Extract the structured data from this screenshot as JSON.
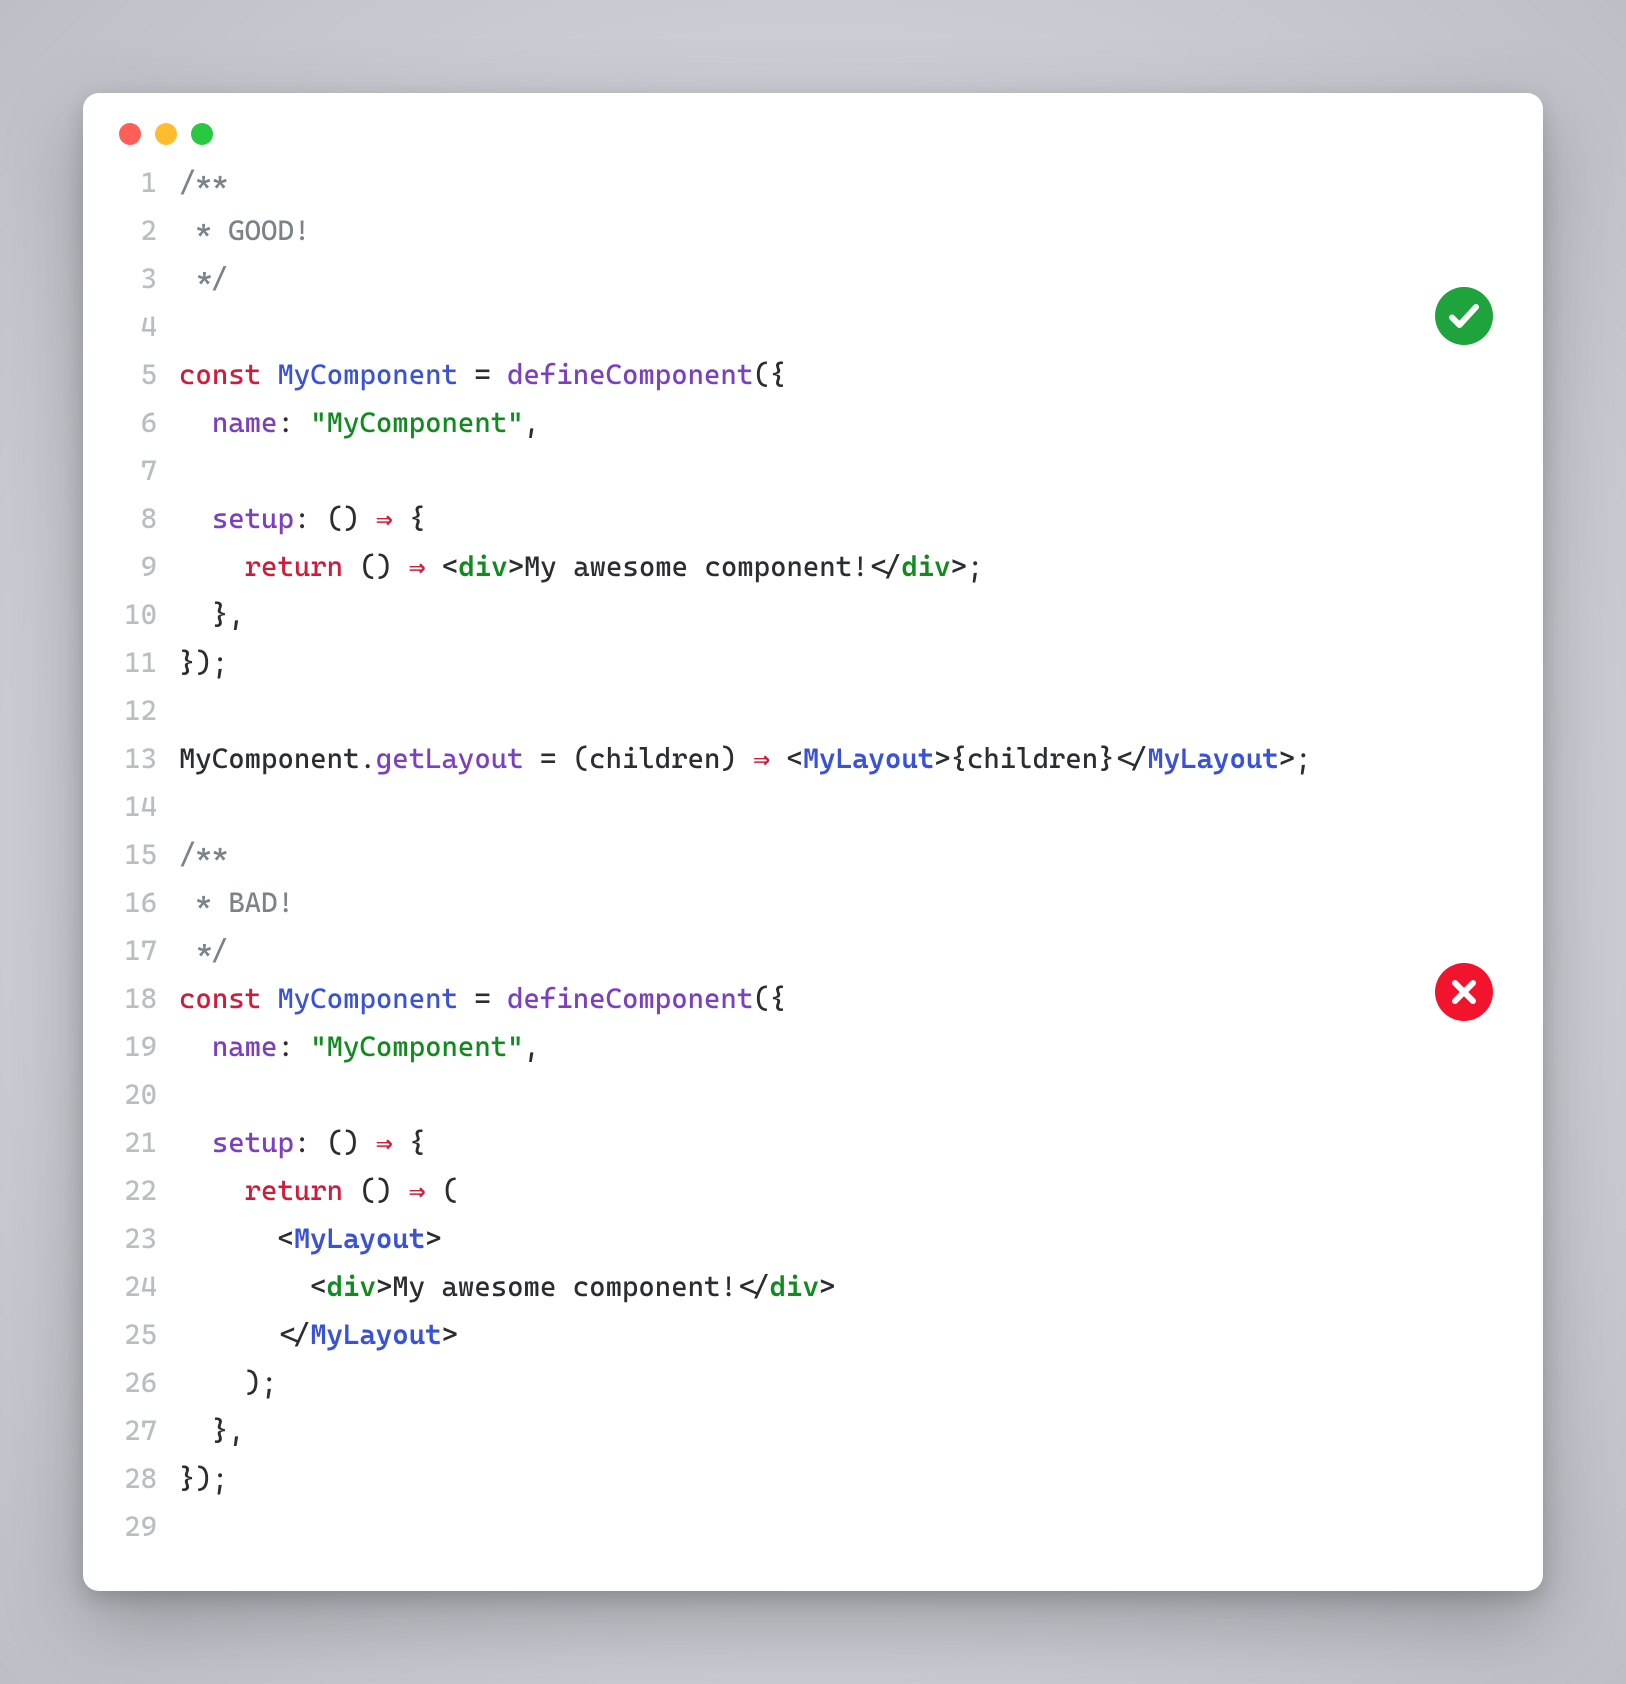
{
  "traffic_lights": [
    "red",
    "yellow",
    "green"
  ],
  "badges": {
    "good": {
      "type": "check",
      "color": "#1fa33c"
    },
    "bad": {
      "type": "cross",
      "color": "#f2142c"
    }
  },
  "code": {
    "line_count": 29,
    "lines": [
      {
        "n": 1,
        "tokens": [
          {
            "c": "c-comment",
            "t": "/**"
          }
        ]
      },
      {
        "n": 2,
        "tokens": [
          {
            "c": "c-comment",
            "t": " * GOOD!"
          }
        ]
      },
      {
        "n": 3,
        "tokens": [
          {
            "c": "c-comment",
            "t": " */"
          }
        ]
      },
      {
        "n": 4,
        "tokens": []
      },
      {
        "n": 5,
        "tokens": [
          {
            "c": "c-keyword",
            "t": "const "
          },
          {
            "c": "c-ident",
            "t": "MyComponent"
          },
          {
            "c": "c-punc",
            "t": " = "
          },
          {
            "c": "c-prop",
            "t": "defineComponent"
          },
          {
            "c": "c-punc",
            "t": "({"
          }
        ]
      },
      {
        "n": 6,
        "tokens": [
          {
            "c": "c-punc",
            "t": "  "
          },
          {
            "c": "c-prop",
            "t": "name"
          },
          {
            "c": "c-punc",
            "t": ": "
          },
          {
            "c": "c-string",
            "t": "\"MyComponent\""
          },
          {
            "c": "c-punc",
            "t": ","
          }
        ]
      },
      {
        "n": 7,
        "tokens": []
      },
      {
        "n": 8,
        "tokens": [
          {
            "c": "c-punc",
            "t": "  "
          },
          {
            "c": "c-prop",
            "t": "setup"
          },
          {
            "c": "c-punc",
            "t": ": () "
          },
          {
            "c": "c-arrow",
            "t": "⇒"
          },
          {
            "c": "c-punc",
            "t": " {"
          }
        ]
      },
      {
        "n": 9,
        "tokens": [
          {
            "c": "c-punc",
            "t": "    "
          },
          {
            "c": "c-keyword",
            "t": "return"
          },
          {
            "c": "c-punc",
            "t": " () "
          },
          {
            "c": "c-arrow",
            "t": "⇒"
          },
          {
            "c": "c-punc",
            "t": " <"
          },
          {
            "c": "c-tag",
            "t": "div"
          },
          {
            "c": "c-punc",
            "t": ">"
          },
          {
            "c": "c-text",
            "t": "My awesome component!"
          },
          {
            "c": "c-punc",
            "t": "</"
          },
          {
            "c": "c-tag",
            "t": "div"
          },
          {
            "c": "c-punc",
            "t": ">;"
          }
        ]
      },
      {
        "n": 10,
        "tokens": [
          {
            "c": "c-punc",
            "t": "  },"
          }
        ]
      },
      {
        "n": 11,
        "tokens": [
          {
            "c": "c-punc",
            "t": "});"
          }
        ]
      },
      {
        "n": 12,
        "tokens": []
      },
      {
        "n": 13,
        "tokens": [
          {
            "c": "c-text",
            "t": "MyComponent."
          },
          {
            "c": "c-prop",
            "t": "getLayout"
          },
          {
            "c": "c-punc",
            "t": " = (children) "
          },
          {
            "c": "c-arrow",
            "t": "⇒"
          },
          {
            "c": "c-punc",
            "t": " <"
          },
          {
            "c": "c-tagc",
            "t": "MyLayout"
          },
          {
            "c": "c-punc",
            "t": ">{children}</"
          },
          {
            "c": "c-tagc",
            "t": "MyLayout"
          },
          {
            "c": "c-punc",
            "t": ">;"
          }
        ]
      },
      {
        "n": 14,
        "tokens": []
      },
      {
        "n": 15,
        "tokens": [
          {
            "c": "c-comment",
            "t": "/**"
          }
        ]
      },
      {
        "n": 16,
        "tokens": [
          {
            "c": "c-comment",
            "t": " * BAD!"
          }
        ]
      },
      {
        "n": 17,
        "tokens": [
          {
            "c": "c-comment",
            "t": " */"
          }
        ]
      },
      {
        "n": 18,
        "tokens": [
          {
            "c": "c-keyword",
            "t": "const "
          },
          {
            "c": "c-ident",
            "t": "MyComponent"
          },
          {
            "c": "c-punc",
            "t": " = "
          },
          {
            "c": "c-prop",
            "t": "defineComponent"
          },
          {
            "c": "c-punc",
            "t": "({"
          }
        ]
      },
      {
        "n": 19,
        "tokens": [
          {
            "c": "c-punc",
            "t": "  "
          },
          {
            "c": "c-prop",
            "t": "name"
          },
          {
            "c": "c-punc",
            "t": ": "
          },
          {
            "c": "c-string",
            "t": "\"MyComponent\""
          },
          {
            "c": "c-punc",
            "t": ","
          }
        ]
      },
      {
        "n": 20,
        "tokens": []
      },
      {
        "n": 21,
        "tokens": [
          {
            "c": "c-punc",
            "t": "  "
          },
          {
            "c": "c-prop",
            "t": "setup"
          },
          {
            "c": "c-punc",
            "t": ": () "
          },
          {
            "c": "c-arrow",
            "t": "⇒"
          },
          {
            "c": "c-punc",
            "t": " {"
          }
        ]
      },
      {
        "n": 22,
        "tokens": [
          {
            "c": "c-punc",
            "t": "    "
          },
          {
            "c": "c-keyword",
            "t": "return"
          },
          {
            "c": "c-punc",
            "t": " () "
          },
          {
            "c": "c-arrow",
            "t": "⇒"
          },
          {
            "c": "c-punc",
            "t": " ("
          }
        ]
      },
      {
        "n": 23,
        "tokens": [
          {
            "c": "c-punc",
            "t": "      <"
          },
          {
            "c": "c-tagc",
            "t": "MyLayout"
          },
          {
            "c": "c-punc",
            "t": ">"
          }
        ]
      },
      {
        "n": 24,
        "tokens": [
          {
            "c": "c-punc",
            "t": "        <"
          },
          {
            "c": "c-tag",
            "t": "div"
          },
          {
            "c": "c-punc",
            "t": ">"
          },
          {
            "c": "c-text",
            "t": "My awesome component!"
          },
          {
            "c": "c-punc",
            "t": "</"
          },
          {
            "c": "c-tag",
            "t": "div"
          },
          {
            "c": "c-punc",
            "t": ">"
          }
        ]
      },
      {
        "n": 25,
        "tokens": [
          {
            "c": "c-punc",
            "t": "      </"
          },
          {
            "c": "c-tagc",
            "t": "MyLayout"
          },
          {
            "c": "c-punc",
            "t": ">"
          }
        ]
      },
      {
        "n": 26,
        "tokens": [
          {
            "c": "c-punc",
            "t": "    );"
          }
        ]
      },
      {
        "n": 27,
        "tokens": [
          {
            "c": "c-punc",
            "t": "  },"
          }
        ]
      },
      {
        "n": 28,
        "tokens": [
          {
            "c": "c-punc",
            "t": "});"
          }
        ]
      },
      {
        "n": 29,
        "tokens": []
      }
    ]
  }
}
